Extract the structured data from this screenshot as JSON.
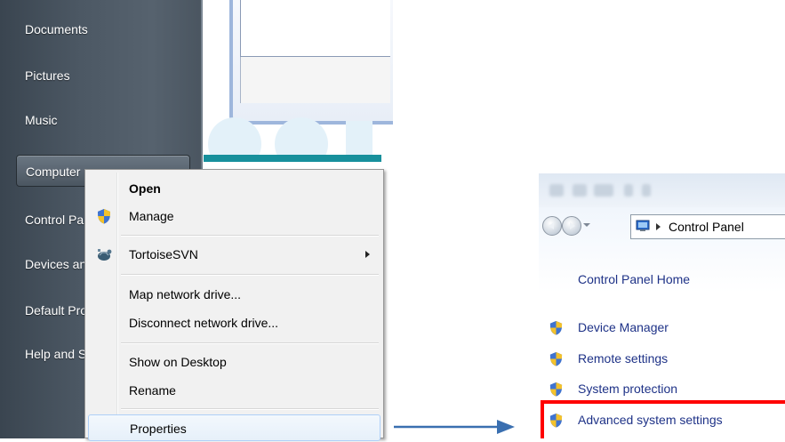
{
  "start_menu": {
    "items": [
      {
        "label": "Documents"
      },
      {
        "label": "Pictures"
      },
      {
        "label": "Music"
      },
      {
        "label": "Computer"
      },
      {
        "label": "Control Panel"
      },
      {
        "label": "Devices and Printers"
      },
      {
        "label": "Default Programs"
      },
      {
        "label": "Help and Support"
      }
    ]
  },
  "context_menu": {
    "items": [
      {
        "label": "Open",
        "bold": true,
        "icon": ""
      },
      {
        "label": "Manage",
        "icon": "uac-shield-icon"
      },
      {
        "label": "TortoiseSVN",
        "icon": "tortoisesvn-icon",
        "submenu": true
      },
      {
        "label": "Map network drive..."
      },
      {
        "label": "Disconnect network drive..."
      },
      {
        "label": "Show on Desktop"
      },
      {
        "label": "Rename"
      },
      {
        "label": "Properties",
        "highlighted": true
      }
    ]
  },
  "control_panel": {
    "address_bar": {
      "text": "Control Panel"
    },
    "home_link": "Control Panel Home",
    "links": [
      {
        "label": "Device Manager",
        "icon": "uac-shield-icon"
      },
      {
        "label": "Remote settings",
        "icon": "uac-shield-icon"
      },
      {
        "label": "System protection",
        "icon": "uac-shield-icon"
      },
      {
        "label": "Advanced system settings",
        "icon": "uac-shield-icon",
        "highlighted": true
      }
    ]
  },
  "colors": {
    "arrow": "#3a6fb0",
    "highlight_box": "#ff0000",
    "link_text": "#1e3287",
    "start_menu_bg": "#4c5864"
  }
}
